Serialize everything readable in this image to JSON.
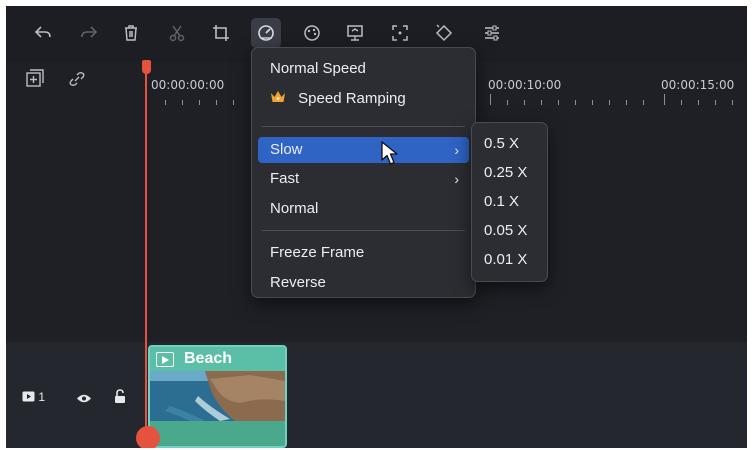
{
  "toolbar": {
    "icons": [
      "undo-icon",
      "redo-icon",
      "delete-icon",
      "cut-icon",
      "crop-icon",
      "speed-icon",
      "color-icon",
      "export-frame-icon",
      "auto-reframe-icon",
      "keyframe-icon",
      "adjust-icon"
    ]
  },
  "ruler": {
    "labels": [
      "00:00:00:00",
      "00:00:10:00",
      "00:00:15:00"
    ]
  },
  "speed_menu": {
    "items": {
      "normal_speed": "Normal Speed",
      "speed_ramping": "Speed Ramping",
      "slow": "Slow",
      "fast": "Fast",
      "normal": "Normal",
      "freeze_frame": "Freeze Frame",
      "reverse": "Reverse"
    },
    "slow_submenu": [
      "0.5 X",
      "0.25 X",
      "0.1 X",
      "0.05 X",
      "0.01 X"
    ]
  },
  "track": {
    "number": "1",
    "clip_label": "Beach"
  },
  "colors": {
    "accent": "#2f63c4",
    "playhead": "#e5533f",
    "clip": "#4aa88c"
  }
}
